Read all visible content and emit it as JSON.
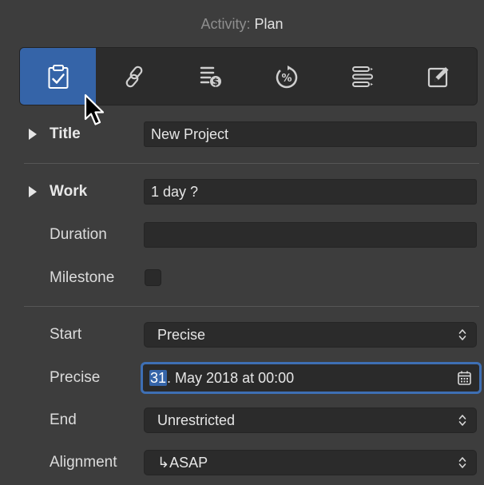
{
  "header": {
    "title_prefix": "Activity:",
    "title_value": "Plan"
  },
  "toolbar": {
    "tabs": [
      {
        "icon": "clipboard-check-icon",
        "active": true
      },
      {
        "icon": "link-icon",
        "active": false
      },
      {
        "icon": "cost-list-icon",
        "active": false
      },
      {
        "icon": "percent-progress-icon",
        "active": false
      },
      {
        "icon": "outline-list-icon",
        "active": false
      },
      {
        "icon": "edit-note-icon",
        "active": false
      }
    ]
  },
  "fields": {
    "title": {
      "label": "Title",
      "value": "New Project"
    },
    "work": {
      "label": "Work",
      "value": "1 day ?"
    },
    "duration": {
      "label": "Duration",
      "value": ""
    },
    "milestone": {
      "label": "Milestone",
      "checked": false
    },
    "start": {
      "label": "Start",
      "value": "Precise"
    },
    "precise": {
      "label": "Precise",
      "value_selected": "31",
      "value_rest": ". May 2018 at 00:00"
    },
    "end": {
      "label": "End",
      "value": "Unrestricted"
    },
    "alignment": {
      "label": "Alignment",
      "value": "↳ASAP"
    }
  },
  "colors": {
    "accent": "#3564a8",
    "focus_ring": "#3e6fb4",
    "background": "#3d3d3d"
  }
}
